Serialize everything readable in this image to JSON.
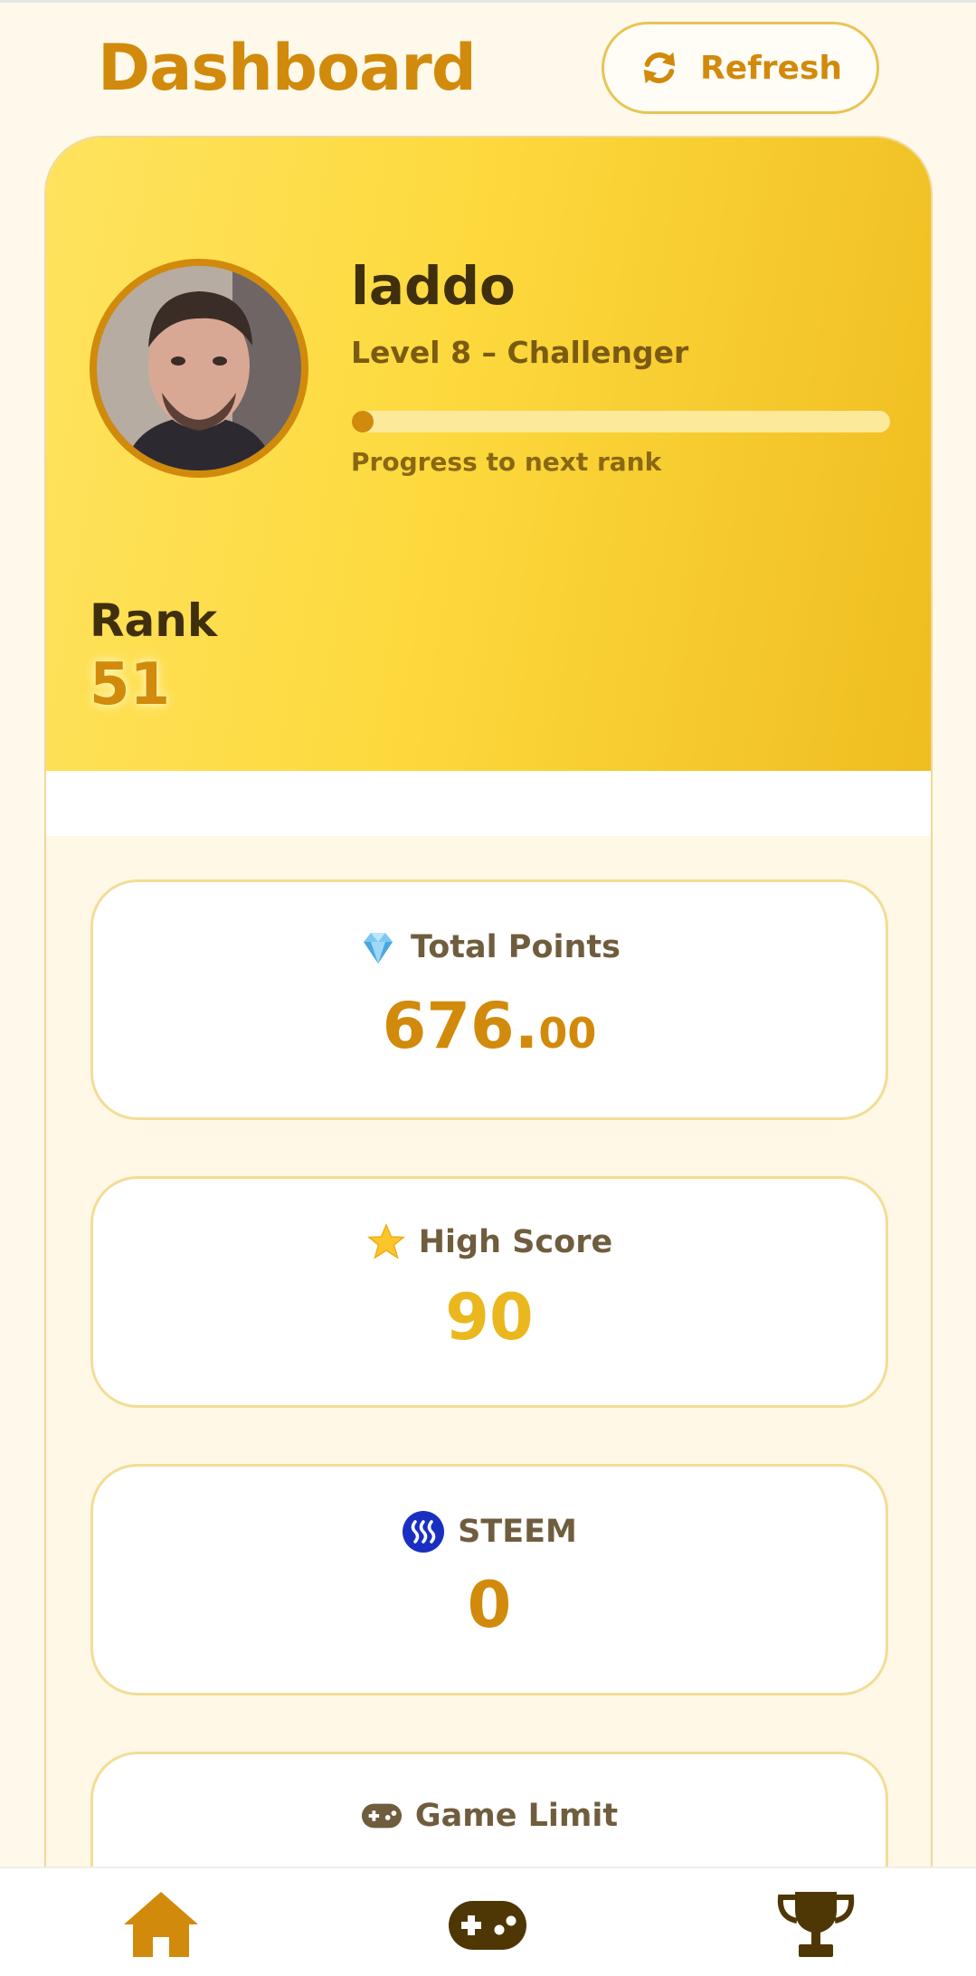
{
  "header": {
    "title": "Dashboard",
    "refresh_label": "Refresh"
  },
  "profile": {
    "username": "laddo",
    "level_text": "Level 8 – Challenger",
    "progress_label": "Progress to next rank",
    "progress_fraction": 0.0,
    "rank_label": "Rank",
    "rank_value": "51"
  },
  "stats": {
    "total_points": {
      "label": "Total Points",
      "value_int": "676.",
      "value_dec": "00",
      "icon": "diamond-icon"
    },
    "high_score": {
      "label": "High Score",
      "value": "90",
      "icon": "star-icon"
    },
    "steem": {
      "label": "STEEM",
      "value": "0",
      "icon": "steem-logo-icon"
    },
    "game_limit": {
      "label": "Game Limit",
      "icon": "gamepad-icon"
    }
  },
  "nav": {
    "items": [
      "home-icon",
      "gamepad-icon",
      "trophy-icon"
    ]
  },
  "colors": {
    "accent": "#d18a0b",
    "card_border": "#f2dd96",
    "dark": "#3f2f0c",
    "gold": "#eab81e"
  }
}
